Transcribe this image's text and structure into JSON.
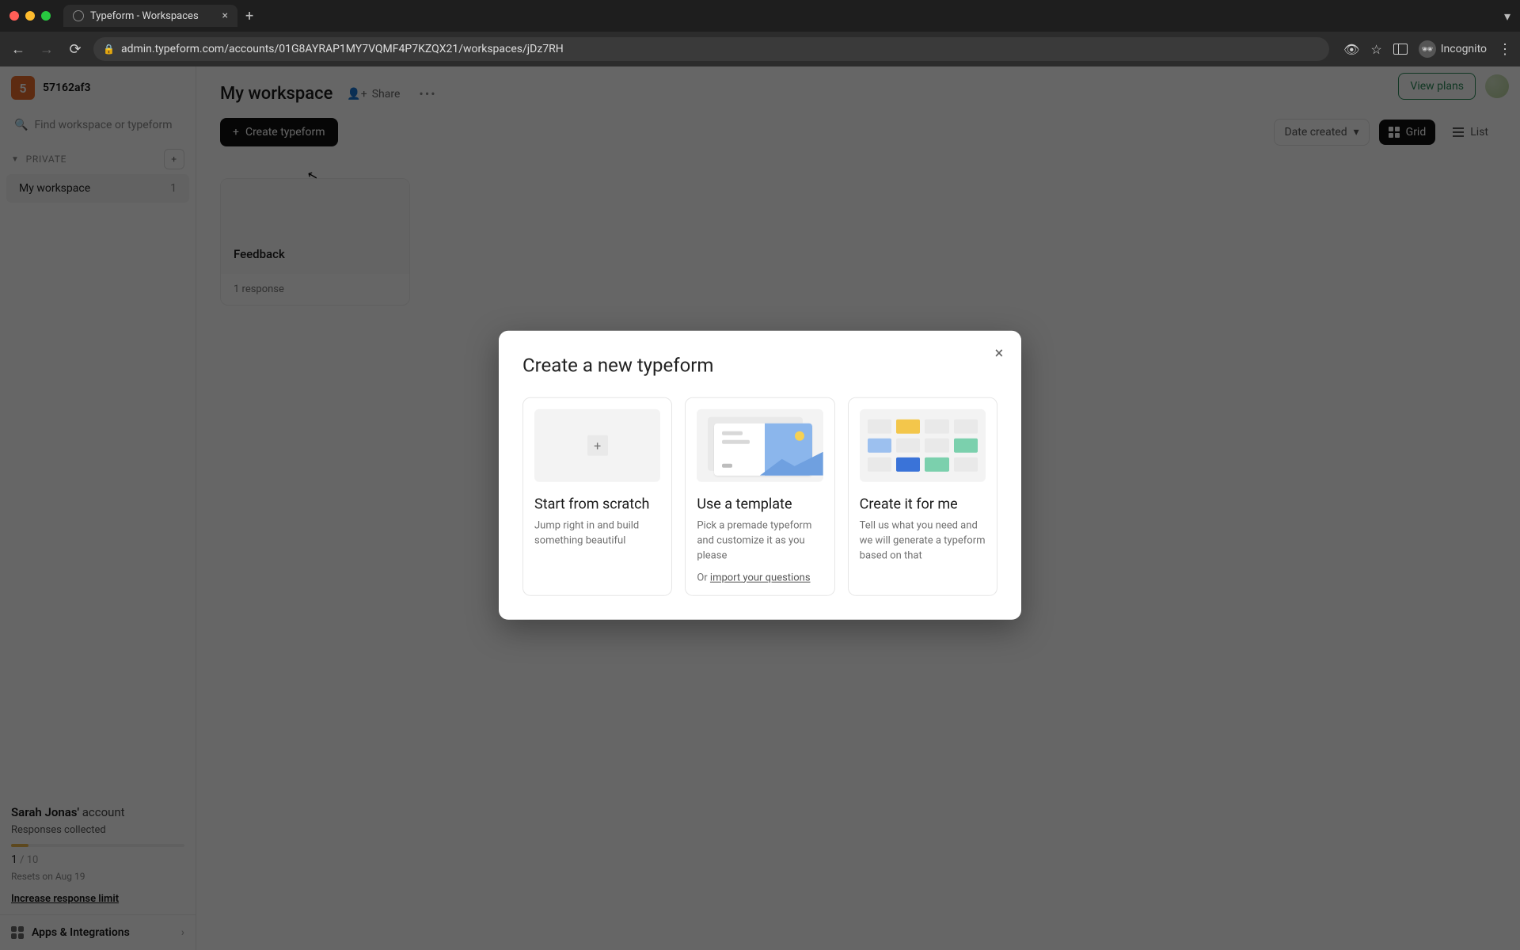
{
  "browser": {
    "tab_title": "Typeform - Workspaces",
    "url": "admin.typeform.com/accounts/01G8AYRAP1MY7VQMF4P7KZQX21/workspaces/jDz7RH",
    "incognito_label": "Incognito"
  },
  "header": {
    "badge_letter": "5",
    "account_code": "57162af3",
    "view_plans": "View plans"
  },
  "sidebar": {
    "search_placeholder": "Find workspace or typeform",
    "private_label": "PRIVATE",
    "add_label": "+",
    "workspaces": [
      {
        "name": "My workspace",
        "count": "1"
      }
    ],
    "account_name": "Sarah Jonas'",
    "account_suffix": "account",
    "responses_label": "Responses collected",
    "responses_used": "1",
    "responses_sep": " / ",
    "responses_total": "10",
    "reset_label": "Resets on Aug 19",
    "increase_label": "Increase response limit",
    "apps_label": "Apps & Integrations"
  },
  "main": {
    "title": "My workspace",
    "share": "Share",
    "create_button": "Create typeform",
    "sort_label": "Date created",
    "view_grid": "Grid",
    "view_list": "List",
    "form": {
      "title": "Feedback",
      "responses": "1 response"
    }
  },
  "modal": {
    "title": "Create a new typeform",
    "cards": [
      {
        "title": "Start from scratch",
        "desc": "Jump right in and build something beautiful"
      },
      {
        "title": "Use a template",
        "desc": "Pick a premade typeform and customize it as you please",
        "extra_prefix": "Or ",
        "extra_link": "import your questions"
      },
      {
        "title": "Create it for me",
        "desc": "Tell us what you need and we will generate a typeform based on that"
      }
    ]
  }
}
